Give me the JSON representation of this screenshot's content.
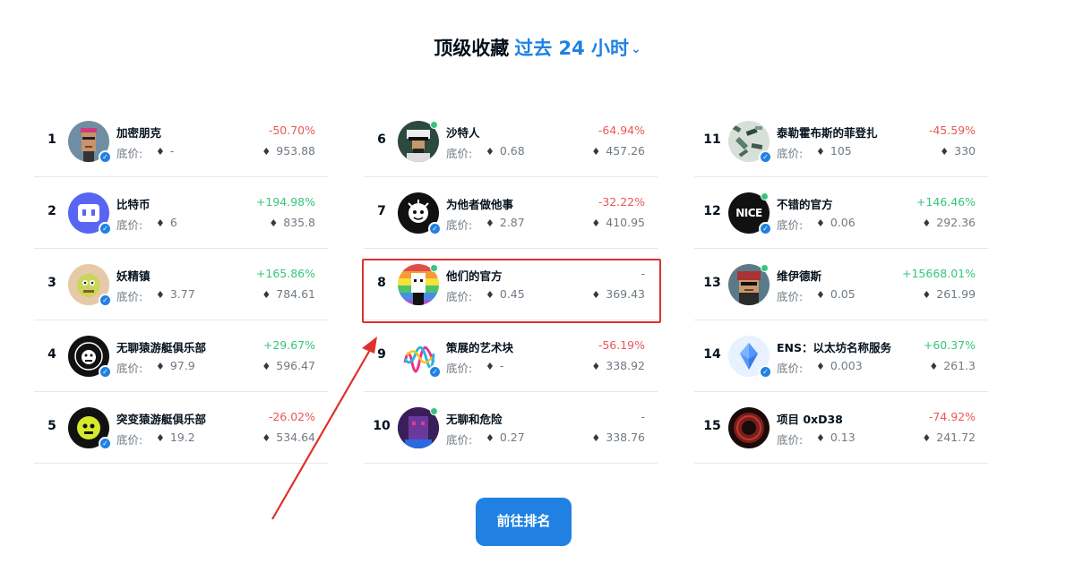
{
  "header": {
    "title": "顶级收藏",
    "period": "过去 24 小时",
    "chevron_icon": "chevron-down-icon"
  },
  "floor_label": "底价:",
  "cta_label": "前往排名",
  "colors": {
    "accent": "#2081e2",
    "negative": "#eb5757",
    "positive": "#34c77b",
    "highlight": "#e0302b"
  },
  "columns": [
    [
      {
        "rank": "1",
        "name": "加密朋克",
        "floor": "-",
        "change": "-50.70%",
        "trend": "neg",
        "volume": "953.88",
        "verified": true,
        "online": false,
        "avatar": "cryptopunk"
      },
      {
        "rank": "2",
        "name": "比特币",
        "floor": "6",
        "change": "+194.98%",
        "trend": "pos",
        "volume": "835.8",
        "verified": true,
        "online": false,
        "avatar": "discord-like"
      },
      {
        "rank": "3",
        "name": "妖精镇",
        "floor": "3.77",
        "change": "+165.86%",
        "trend": "pos",
        "volume": "784.61",
        "verified": true,
        "online": false,
        "avatar": "goblin"
      },
      {
        "rank": "4",
        "name": "无聊猿游艇俱乐部",
        "floor": "97.9",
        "change": "+29.67%",
        "trend": "pos",
        "volume": "596.47",
        "verified": true,
        "online": false,
        "avatar": "bayc"
      },
      {
        "rank": "5",
        "name": "突变猿游艇俱乐部",
        "floor": "19.2",
        "change": "-26.02%",
        "trend": "neg",
        "volume": "534.64",
        "verified": true,
        "online": false,
        "avatar": "mayc"
      }
    ],
    [
      {
        "rank": "6",
        "name": "沙特人",
        "floor": "0.68",
        "change": "-64.94%",
        "trend": "neg",
        "volume": "457.26",
        "verified": false,
        "online": true,
        "avatar": "saudi"
      },
      {
        "rank": "7",
        "name": "为他者做他事",
        "floor": "2.87",
        "change": "-32.22%",
        "trend": "neg",
        "volume": "410.95",
        "verified": true,
        "online": false,
        "avatar": "otherside"
      },
      {
        "rank": "8",
        "name": "他们的官方",
        "floor": "0.45",
        "change": "-",
        "trend": "none",
        "volume": "369.43",
        "verified": false,
        "online": true,
        "avatar": "rainbow"
      },
      {
        "rank": "9",
        "name": "策展的艺术块",
        "floor": "-",
        "change": "-56.19%",
        "trend": "neg",
        "volume": "338.92",
        "verified": true,
        "online": false,
        "avatar": "artblocks"
      },
      {
        "rank": "10",
        "name": "无聊和危险",
        "floor": "0.27",
        "change": "-",
        "trend": "none",
        "volume": "338.76",
        "verified": false,
        "online": true,
        "avatar": "purple"
      }
    ],
    [
      {
        "rank": "11",
        "name": "泰勒霍布斯的菲登扎",
        "floor": "105",
        "change": "-45.59%",
        "trend": "neg",
        "volume": "330",
        "verified": true,
        "online": false,
        "avatar": "fidenza"
      },
      {
        "rank": "12",
        "name": "不错的官方",
        "floor": "0.06",
        "change": "+146.46%",
        "trend": "pos",
        "volume": "292.36",
        "verified": true,
        "online": true,
        "avatar": "nice"
      },
      {
        "rank": "13",
        "name": "维伊德斯",
        "floor": "0.05",
        "change": "+15668.01%",
        "trend": "pos",
        "volume": "261.99",
        "verified": false,
        "online": true,
        "avatar": "pixelhead"
      },
      {
        "rank": "14",
        "name": "ENS：以太坊名称服务",
        "floor": "0.003",
        "change": "+60.37%",
        "trend": "pos",
        "volume": "261.3",
        "verified": true,
        "online": false,
        "avatar": "ens"
      },
      {
        "rank": "15",
        "name": "项目 0xD38",
        "floor": "0.13",
        "change": "-74.92%",
        "trend": "neg",
        "volume": "241.72",
        "verified": false,
        "online": false,
        "avatar": "donut"
      }
    ]
  ]
}
